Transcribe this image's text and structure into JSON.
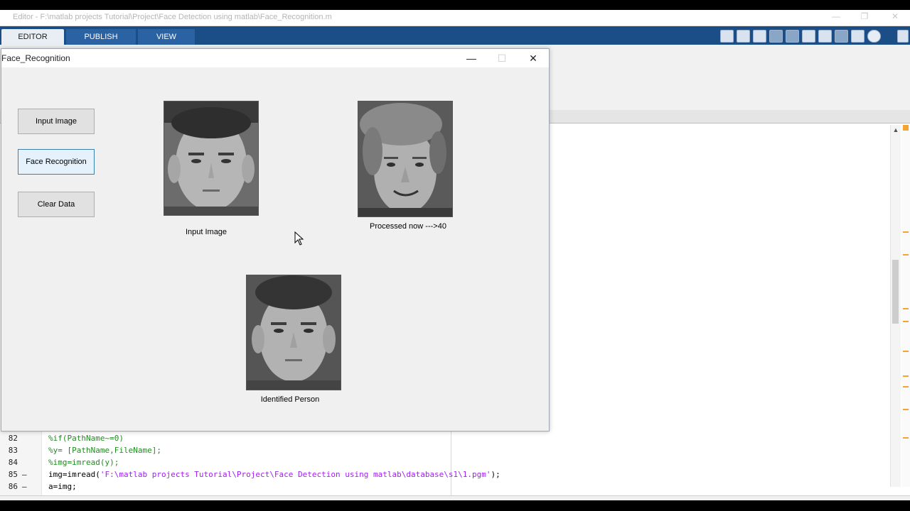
{
  "window": {
    "title": "Editor - F:\\matlab projects Tutorial\\Project\\Face Detection using matlab\\Face_Recognition.m",
    "minimize": "—",
    "restore": "❐",
    "close": "✕"
  },
  "ribbon": {
    "tabs": [
      {
        "label": "EDITOR",
        "active": true
      },
      {
        "label": "PUBLISH",
        "active": false
      },
      {
        "label": "VIEW",
        "active": false
      }
    ],
    "accent": "#1b4e87"
  },
  "figure": {
    "title": "Face_Recognition",
    "minimize": "—",
    "maximize": "☐",
    "close": "✕",
    "buttons": {
      "input_image": "Input Image",
      "face_recognition": "Face Recognition",
      "clear_data": "Clear Data"
    },
    "labels": {
      "input_image": "Input Image",
      "processed": "Processed now --->40",
      "identified": "Identified Person"
    }
  },
  "code": {
    "lines": [
      {
        "num": "82",
        "marker": "",
        "text": "%if(PathName~=0)",
        "kind": "comment"
      },
      {
        "num": "83",
        "marker": "",
        "text": "%y= [PathName,FileName];",
        "kind": "comment"
      },
      {
        "num": "84",
        "marker": "",
        "text": "%img=imread(y);",
        "kind": "comment"
      },
      {
        "num": "85",
        "marker": "–",
        "prefix": "img=imread(",
        "string": "'F:\\matlab projects Tutorial\\Project\\Face Detection using matlab\\database\\s1\\1.pgm'",
        "suffix": ");",
        "kind": "mixed"
      },
      {
        "num": "86",
        "marker": "–",
        "text": "a=img;",
        "kind": "code"
      }
    ]
  }
}
